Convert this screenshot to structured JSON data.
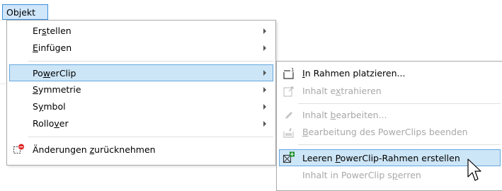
{
  "menubar": {
    "objekt": "Objekt"
  },
  "menu": {
    "items": [
      {
        "label_pre": "Er",
        "accel": "s",
        "label_post": "tellen"
      },
      {
        "label_pre": "",
        "accel": "E",
        "label_post": "infügen"
      },
      {
        "label_pre": "Po",
        "accel": "w",
        "label_post": "erClip"
      },
      {
        "label_pre": "",
        "accel": "S",
        "label_post": "ymmetrie"
      },
      {
        "label_pre": "S",
        "accel": "y",
        "label_post": "mbol"
      },
      {
        "label_pre": "Rollo",
        "accel": "v",
        "label_post": "er"
      },
      {
        "label_pre": "Änderungen ",
        "accel": "z",
        "label_post": "urücknehmen"
      }
    ]
  },
  "submenu": {
    "items": [
      {
        "label_pre": "",
        "accel": "I",
        "label_post": "n Rahmen platzieren..."
      },
      {
        "label_pre": "Inhalt e",
        "accel": "x",
        "label_post": "trahieren"
      },
      {
        "label_pre": "Inhalt ",
        "accel": "b",
        "label_post": "earbeiten..."
      },
      {
        "label_pre": "",
        "accel": "B",
        "label_post": "earbeitung des PowerClips beenden"
      },
      {
        "label_pre": "Leeren ",
        "accel": "P",
        "label_post": "owerClip-Rahmen erstellen"
      },
      {
        "label_pre": "Inhalt in PowerClip s",
        "accel": "p",
        "label_post": "erren"
      }
    ]
  },
  "colors": {
    "highlight_bg": "#cde6f7",
    "highlight_border": "#66a7e0",
    "disabled_text": "#a8a8a8"
  }
}
